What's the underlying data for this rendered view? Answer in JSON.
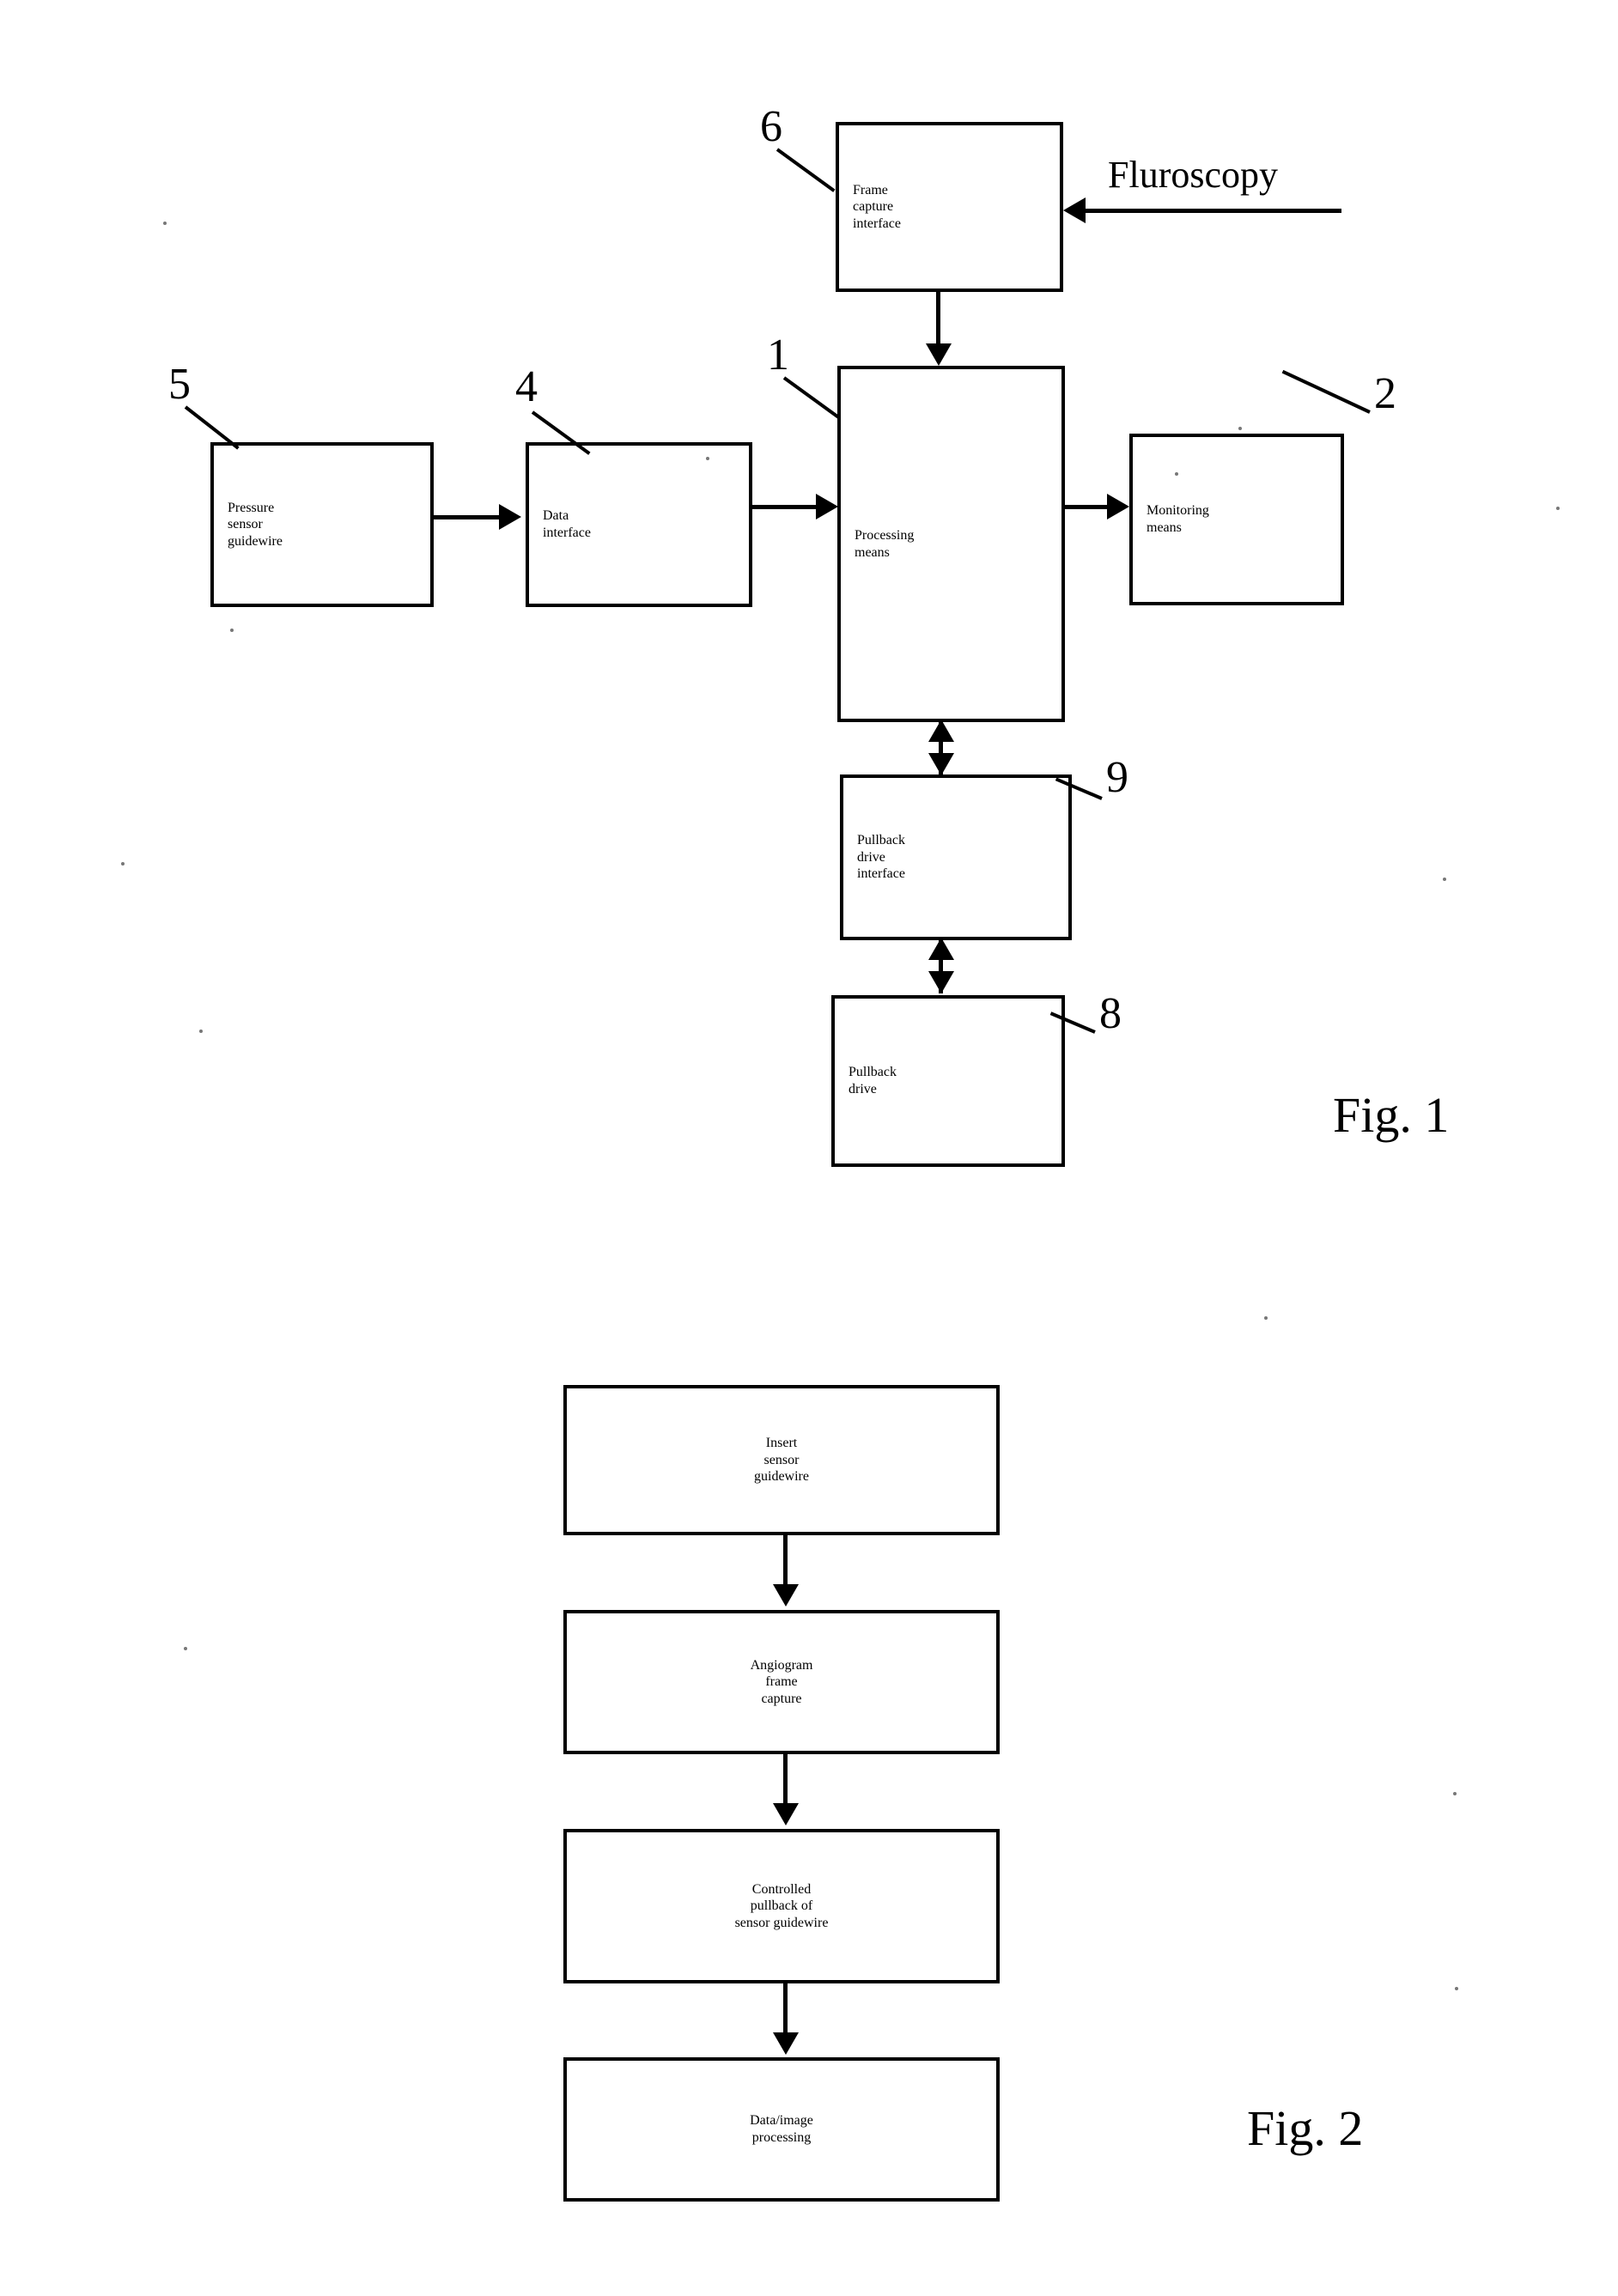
{
  "document": {
    "type": "patent-figure-sheet",
    "figures": [
      "Fig. 1",
      "Fig. 2"
    ]
  },
  "fig1": {
    "caption": "Fig. 1",
    "external_labels": [
      {
        "name": "fluroscopy",
        "text": "Fluroscopy"
      }
    ],
    "blocks": [
      {
        "id": "frame_capture_interface",
        "ref": "6",
        "lines": [
          "Frame",
          "capture",
          "interface"
        ]
      },
      {
        "id": "processing_means",
        "ref": "1",
        "lines": [
          "Processing",
          "means"
        ]
      },
      {
        "id": "monitoring_means",
        "ref": "2",
        "lines": [
          "Monitoring",
          "means"
        ]
      },
      {
        "id": "data_interface",
        "ref": "4",
        "lines": [
          "Data",
          "interface"
        ]
      },
      {
        "id": "pressure_sensor_guidewire",
        "ref": "5",
        "lines": [
          "Pressure",
          "sensor",
          "guidewire"
        ]
      },
      {
        "id": "pullback_drive_interface",
        "ref": "9",
        "lines": [
          "Pullback",
          "drive",
          "interface"
        ]
      },
      {
        "id": "pullback_drive",
        "ref": "8",
        "lines": [
          "Pullback",
          "drive"
        ]
      }
    ],
    "connections": [
      {
        "from": "fluroscopy",
        "to": "frame_capture_interface",
        "style": "arrow-left"
      },
      {
        "from": "frame_capture_interface",
        "to": "processing_means",
        "style": "arrow-down"
      },
      {
        "from": "pressure_sensor_guidewire",
        "to": "data_interface",
        "style": "arrow-right"
      },
      {
        "from": "data_interface",
        "to": "processing_means",
        "style": "arrow-right"
      },
      {
        "from": "processing_means",
        "to": "monitoring_means",
        "style": "arrow-right"
      },
      {
        "from": "processing_means",
        "to": "pullback_drive_interface",
        "style": "double-arrow-vertical"
      },
      {
        "from": "pullback_drive_interface",
        "to": "pullback_drive",
        "style": "double-arrow-vertical"
      }
    ]
  },
  "fig2": {
    "caption": "Fig. 2",
    "steps": [
      {
        "id": "step1",
        "lines": [
          "Insert",
          "sensor",
          "guidewire"
        ]
      },
      {
        "id": "step2",
        "lines": [
          "Angiogram",
          "frame",
          "capture"
        ]
      },
      {
        "id": "step3",
        "lines": [
          "Controlled",
          "pullback of",
          "sensor guidewire"
        ]
      },
      {
        "id": "step4",
        "lines": [
          "Data/image",
          "processing"
        ]
      }
    ],
    "connections": [
      {
        "from": "step1",
        "to": "step2",
        "style": "arrow-down"
      },
      {
        "from": "step2",
        "to": "step3",
        "style": "arrow-down"
      },
      {
        "from": "step3",
        "to": "step4",
        "style": "arrow-down"
      }
    ]
  },
  "colors": {
    "ink": "#000000",
    "paper": "#ffffff"
  }
}
